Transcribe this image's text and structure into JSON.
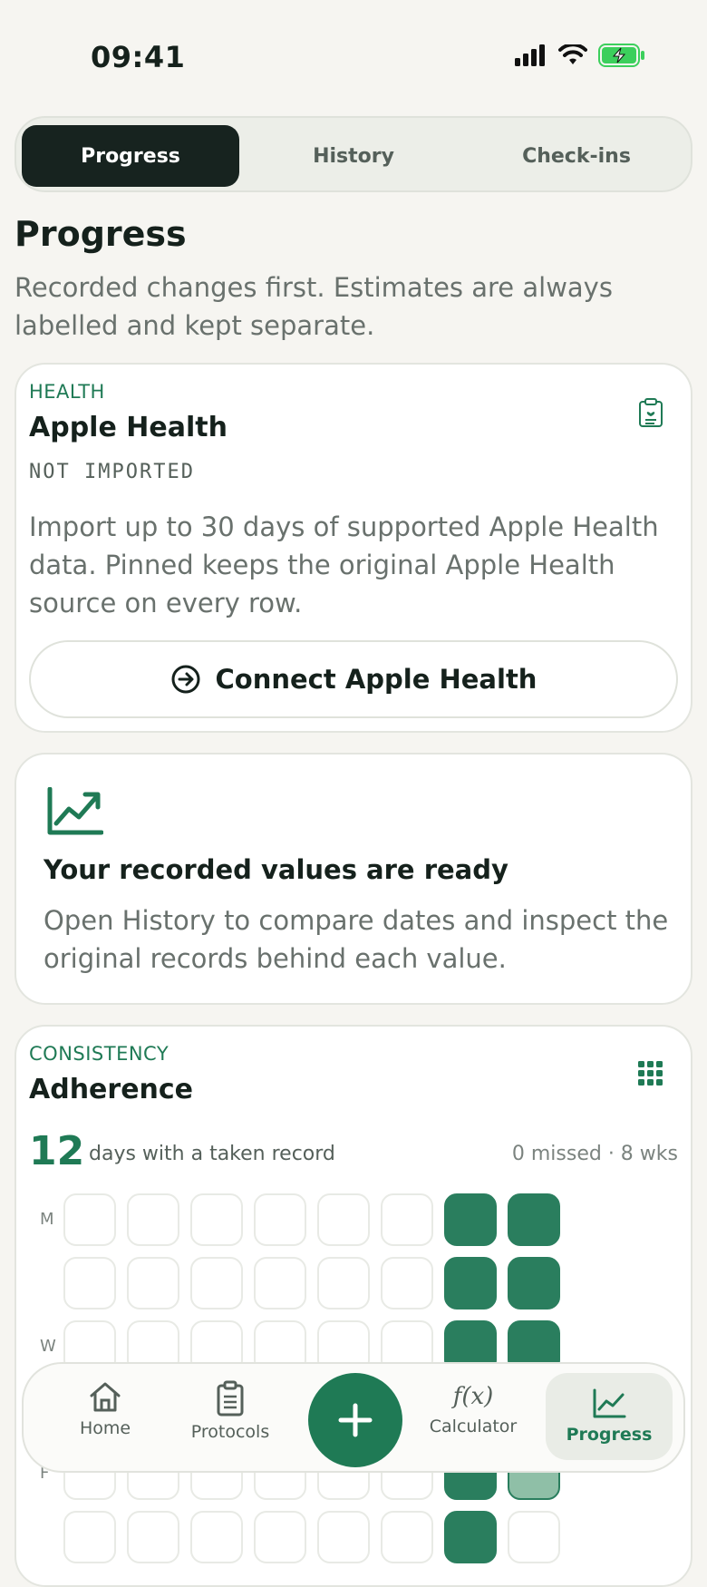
{
  "status_bar": {
    "time": "09:41"
  },
  "segmented_control": {
    "tabs": [
      {
        "label": "Progress",
        "active": true
      },
      {
        "label": "History",
        "active": false
      },
      {
        "label": "Check-ins",
        "active": false
      }
    ]
  },
  "page": {
    "title": "Progress",
    "subtitle": "Recorded changes first. Estimates are always labelled and kept separate."
  },
  "health_card": {
    "eyebrow": "HEALTH",
    "title": "Apple Health",
    "status": "NOT IMPORTED",
    "body": "Import up to 30 days of supported Apple Health data. Pinned keeps the original Apple Health source on every row.",
    "button_label": "Connect Apple Health",
    "icon": "clipboard-heart-icon"
  },
  "ready_card": {
    "icon": "trend-chart-icon",
    "title": "Your recorded values are ready",
    "body": "Open History to compare dates and inspect the original records behind each value."
  },
  "adherence_card": {
    "eyebrow": "CONSISTENCY",
    "title": "Adherence",
    "count": "12",
    "caption": "days with a taken record",
    "meta": "0 missed · 8 wks",
    "day_labels": [
      "M",
      "",
      "W",
      "",
      "F",
      ""
    ],
    "grid": [
      [
        0,
        0,
        0,
        0,
        0,
        0,
        1,
        1
      ],
      [
        0,
        0,
        0,
        0,
        0,
        0,
        1,
        1
      ],
      [
        0,
        0,
        0,
        0,
        0,
        0,
        1,
        1
      ],
      [
        0,
        0,
        0,
        0,
        0,
        0,
        1,
        1
      ],
      [
        0,
        0,
        0,
        0,
        0,
        0,
        1,
        2
      ],
      [
        0,
        0,
        0,
        0,
        0,
        0,
        1,
        0
      ]
    ]
  },
  "tab_bar": {
    "items": [
      {
        "label": "Home",
        "icon": "home-icon"
      },
      {
        "label": "Protocols",
        "icon": "clipboard-list-icon"
      },
      {
        "label": "Calculator",
        "icon": "function-icon"
      },
      {
        "label": "Progress",
        "icon": "chart-line-icon",
        "active": true
      }
    ],
    "add_icon": "plus-icon"
  },
  "colors": {
    "accent": "#1f7a55",
    "dark": "#17231f",
    "background": "#f6f5f1"
  }
}
